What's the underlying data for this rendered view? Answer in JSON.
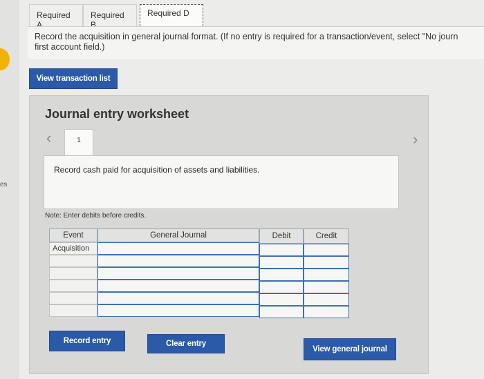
{
  "sidebar": {
    "edge_text": "es"
  },
  "tabs": [
    {
      "label": "Required A"
    },
    {
      "label": "Required B"
    },
    {
      "label": "Required D"
    }
  ],
  "instruction": {
    "line1": "Record the acquisition in general journal format. (If no entry is required for a transaction/event, select \"No journ",
    "line2": "first account field.)"
  },
  "buttons": {
    "view_transaction_list": "View transaction list",
    "record_entry": "Record entry",
    "clear_entry": "Clear entry",
    "view_general_journal": "View general journal"
  },
  "worksheet": {
    "title": "Journal entry worksheet",
    "current_step": "1",
    "description": "Record cash paid for acquisition of assets and liabilities.",
    "note": "Note: Enter debits before credits."
  },
  "journal": {
    "headers": {
      "event": "Event",
      "account": "General Journal",
      "debit": "Debit",
      "credit": "Credit"
    },
    "rows": [
      {
        "event": "Acquisition",
        "account": "",
        "debit": "",
        "credit": ""
      },
      {
        "event": "",
        "account": "",
        "debit": "",
        "credit": ""
      },
      {
        "event": "",
        "account": "",
        "debit": "",
        "credit": ""
      },
      {
        "event": "",
        "account": "",
        "debit": "",
        "credit": ""
      },
      {
        "event": "",
        "account": "",
        "debit": "",
        "credit": ""
      },
      {
        "event": "",
        "account": "",
        "debit": "",
        "credit": ""
      }
    ]
  },
  "icons": {
    "prev": "chevron-left-icon",
    "next": "chevron-right-icon"
  },
  "colors": {
    "button_blue": "#2a5aa8",
    "input_border": "#3d6fb8",
    "accent_yellow": "#f0b400"
  }
}
